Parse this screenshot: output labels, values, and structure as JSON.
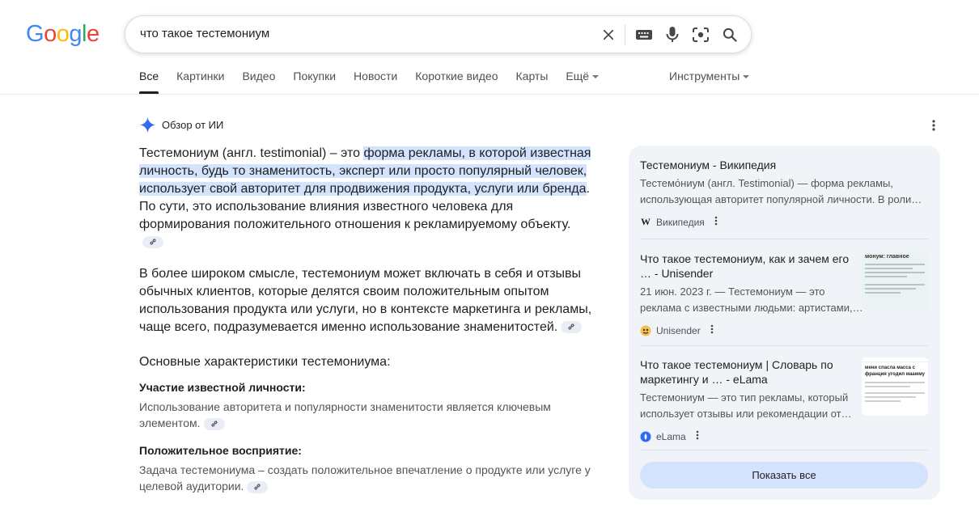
{
  "logo": {
    "text": "Google",
    "colors": [
      "#4285F4",
      "#EA4335",
      "#FBBC05",
      "#4285F4",
      "#34A853",
      "#EA4335"
    ]
  },
  "search": {
    "value": "что такое тестемониум"
  },
  "tabs": [
    {
      "label": "Все",
      "active": true
    },
    {
      "label": "Картинки"
    },
    {
      "label": "Видео"
    },
    {
      "label": "Покупки"
    },
    {
      "label": "Новости"
    },
    {
      "label": "Короткие видео"
    },
    {
      "label": "Карты"
    },
    {
      "label": "Ещё"
    }
  ],
  "tools_label": "Инструменты",
  "ai": {
    "title": "Обзор от ИИ",
    "p1_pre": "Тестемониум (англ. testimonial) – это ",
    "p1_hl": "форма рекламы, в которой известная личность, будь то знаменитость, эксперт или просто популярный человек, использует свой авторитет для продвижения продукта, услуги или бренда",
    "p1_post": ". По сути, это использование влияния известного человека для формирования положительного отношения к рекламируемому объекту.",
    "p2": "В более широком смысле, тестемониум может включать в себя и отзывы обычных клиентов, которые делятся своим положительным опытом использования продукта или услуги, но в контексте маркетинга и рекламы, чаще всего, подразумевается именно использование знаменитостей.",
    "h3": "Основные характеристики тестемониума:",
    "items": [
      {
        "title": "Участие известной личности:",
        "text": "Использование авторитета и популярности знаменитости является ключевым элементом."
      },
      {
        "title": "Положительное восприятие:",
        "text": "Задача тестемониума – создать положительное впечатление о продукте или услуге у целевой аудитории."
      }
    ]
  },
  "sources": [
    {
      "title": "Тестемониум - Википедия",
      "snippet": "Тестемо́ниум (англ. Testimonial) — форма рекламы, использующая авторитет популярной личности. В роли…",
      "site": "Википедия",
      "favicon": "W"
    },
    {
      "title": "Что такое тестемониум, как и зачем его … - Unisender",
      "snippet": "21 июн. 2023 г. — Тестемониум — это реклама с известными людьми: артистами,…",
      "site": "Unisender",
      "thumb_text": "монум: главное"
    },
    {
      "title": "Что такое тестемониум | Словарь по маркетингу и … - eLama",
      "snippet": "Тестемониум — это тип рекламы, который использует отзывы или рекомендации от…",
      "site": "eLama",
      "thumb_text": "мени спасла масса с франция угодил маамму"
    }
  ],
  "show_all_label": "Показать все"
}
